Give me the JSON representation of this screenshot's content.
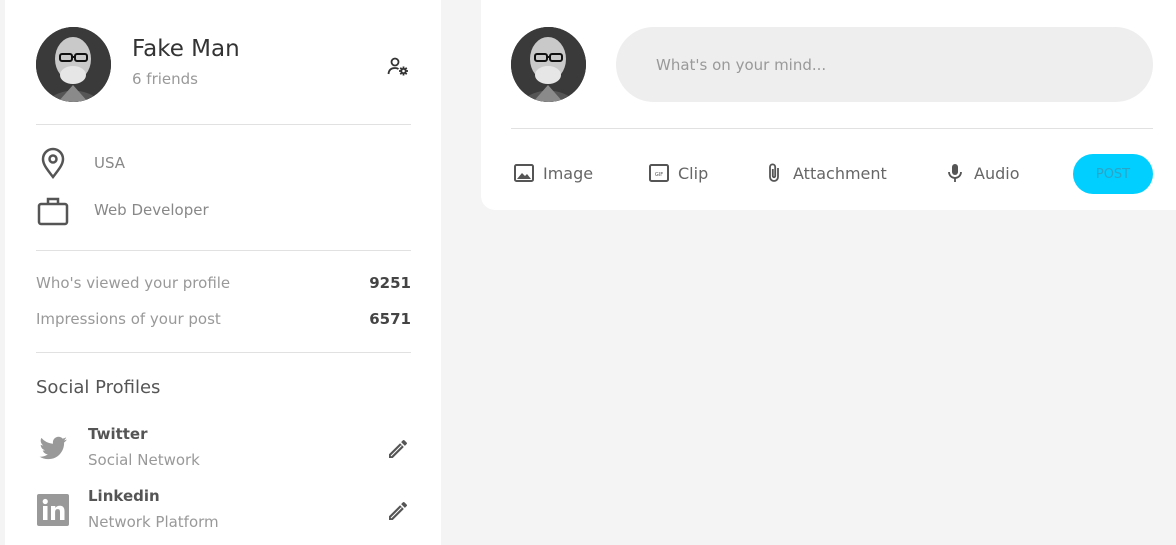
{
  "profile": {
    "name": "Fake Man",
    "friends": "6 friends",
    "location": "USA",
    "job": "Web Developer",
    "stats": [
      {
        "label": "Who's viewed your profile",
        "value": "9251"
      },
      {
        "label": "Impressions of your post",
        "value": "6571"
      }
    ],
    "social_title": "Social Profiles",
    "socials": [
      {
        "name": "Twitter",
        "sub": "Social Network",
        "icon": "twitter-icon"
      },
      {
        "name": "Linkedin",
        "sub": "Network Platform",
        "icon": "linkedin-icon"
      }
    ]
  },
  "composer": {
    "placeholder": "What's on your mind...",
    "tools": [
      {
        "label": "Image",
        "icon": "image-icon"
      },
      {
        "label": "Clip",
        "icon": "gif-icon"
      },
      {
        "label": "Attachment",
        "icon": "paperclip-icon"
      },
      {
        "label": "Audio",
        "icon": "microphone-icon"
      }
    ],
    "post_label": "POST"
  },
  "colors": {
    "accent": "#00cfff",
    "background": "#f4f4f4",
    "card": "#ffffff"
  }
}
